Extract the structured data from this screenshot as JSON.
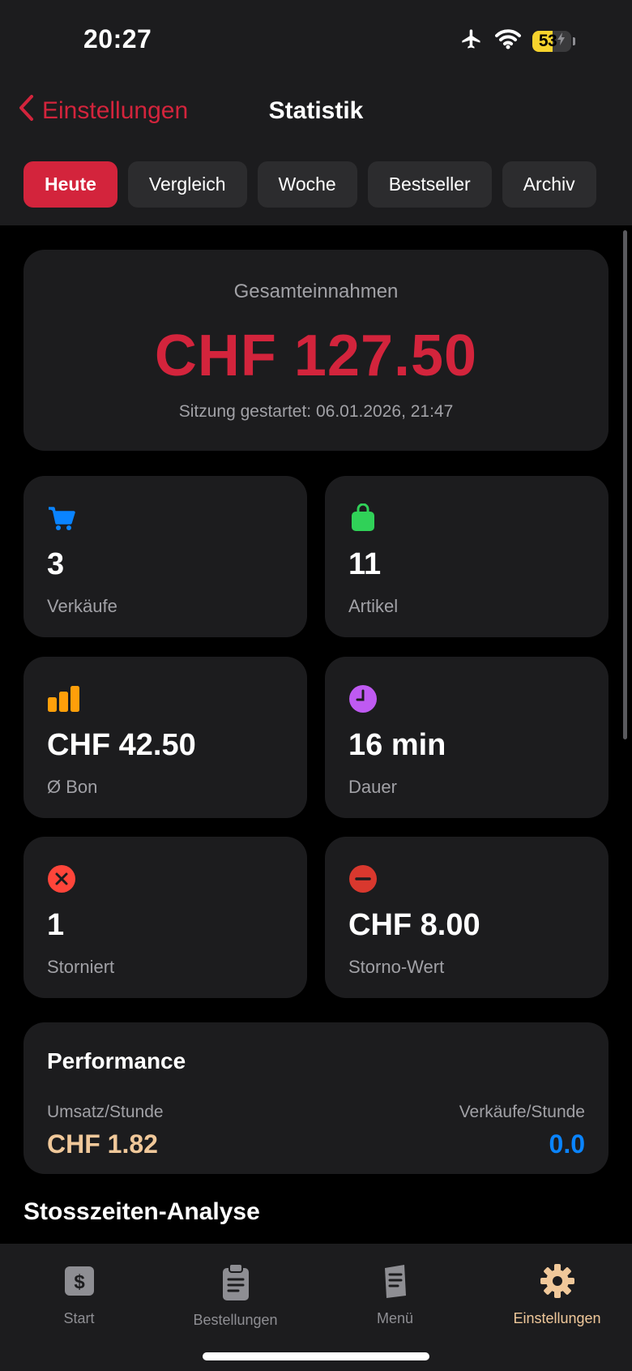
{
  "status_bar": {
    "time": "20:27",
    "battery_percent": "53",
    "battery_level": 0.53,
    "airplane_mode": true,
    "wifi": true,
    "charging": true
  },
  "nav": {
    "back_label": "Einstellungen",
    "title": "Statistik"
  },
  "tabs": [
    {
      "label": "Heute",
      "active": true
    },
    {
      "label": "Vergleich",
      "active": false
    },
    {
      "label": "Woche",
      "active": false
    },
    {
      "label": "Bestseller",
      "active": false
    },
    {
      "label": "Archiv",
      "active": false
    }
  ],
  "revenue": {
    "label": "Gesamteinnahmen",
    "value": "CHF 127.50",
    "session": "Sitzung gestartet: 06.01.2026, 21:47"
  },
  "stats": [
    {
      "icon": "cart-icon",
      "color": "#0a84ff",
      "value": "3",
      "label": "Verkäufe"
    },
    {
      "icon": "bag-icon",
      "color": "#30d158",
      "value": "11",
      "label": "Artikel"
    },
    {
      "icon": "bar-chart-icon",
      "color": "#ff9f0a",
      "value": "CHF 42.50",
      "label": "Ø Bon"
    },
    {
      "icon": "clock-icon",
      "color": "#bf5af2",
      "value": "16 min",
      "label": "Dauer"
    },
    {
      "icon": "x-circle-icon",
      "color": "#ff453a",
      "value": "1",
      "label": "Storniert"
    },
    {
      "icon": "minus-circle-icon",
      "color": "#d9382e",
      "value": "CHF 8.00",
      "label": "Storno-Wert"
    }
  ],
  "performance": {
    "title": "Performance",
    "left_label": "Umsatz/Stunde",
    "left_value": "CHF 1.82",
    "right_label": "Verkäufe/Stunde",
    "right_value": "0.0"
  },
  "section_heading": "Stosszeiten-Analyse",
  "tabbar": [
    {
      "icon": "dollar-icon",
      "label": "Start",
      "active": false
    },
    {
      "icon": "clipboard-icon",
      "label": "Bestellungen",
      "active": false
    },
    {
      "icon": "menu-book-icon",
      "label": "Menü",
      "active": false
    },
    {
      "icon": "gear-icon",
      "label": "Einstellungen",
      "active": true
    }
  ],
  "colors": {
    "accent": "#d3243c",
    "background": "#000000",
    "card": "#1c1c1e",
    "active_tab_label": "#f0c89a",
    "secondary_text": "#a1a1a6"
  }
}
